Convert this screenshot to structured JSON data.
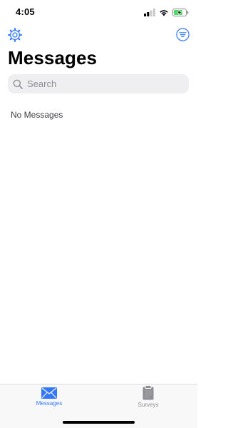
{
  "status_bar": {
    "time": "4:05",
    "icons": [
      "cellular-signal-icon",
      "wifi-icon",
      "battery-charging-icon"
    ]
  },
  "nav": {
    "left_icon": "gear-icon",
    "right_icon": "filter-icon"
  },
  "page": {
    "title": "Messages"
  },
  "search": {
    "placeholder": "Search",
    "value": ""
  },
  "content": {
    "empty_state": "No Messages"
  },
  "tab_bar": {
    "tabs": [
      {
        "label": "Messages",
        "icon": "envelope-icon",
        "selected": true
      },
      {
        "label": "Surveys",
        "icon": "clipboard-icon",
        "selected": false
      }
    ]
  },
  "colors": {
    "accent": "#3478f6",
    "inactive": "#8e8e93",
    "search_bg": "#efeff1",
    "battery_charge": "#4cd964"
  }
}
